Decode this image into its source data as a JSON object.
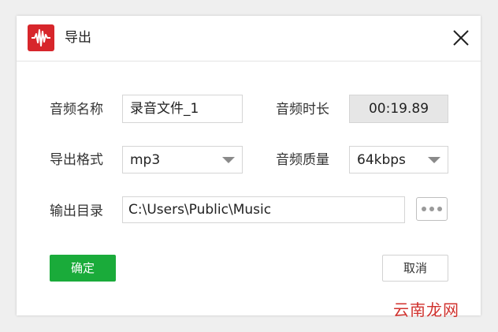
{
  "window": {
    "title": "导出",
    "app_icon": "waveform-icon",
    "close_icon": "close-icon",
    "colors": {
      "accent": "#1aab3a",
      "app_icon_bg": "#d7262b"
    }
  },
  "form": {
    "audio_name": {
      "label": "音频名称",
      "value": "录音文件_1"
    },
    "audio_duration": {
      "label": "音频时长",
      "value": "00:19.89"
    },
    "export_format": {
      "label": "导出格式",
      "value": "mp3"
    },
    "audio_quality": {
      "label": "音频质量",
      "value": "64kbps"
    },
    "output_dir": {
      "label": "输出目录",
      "value": "C:\\Users\\Public\\Music",
      "browse_icon": "more-dots-icon"
    }
  },
  "buttons": {
    "ok": "确定",
    "cancel": "取消"
  },
  "watermark": "云南龙网"
}
